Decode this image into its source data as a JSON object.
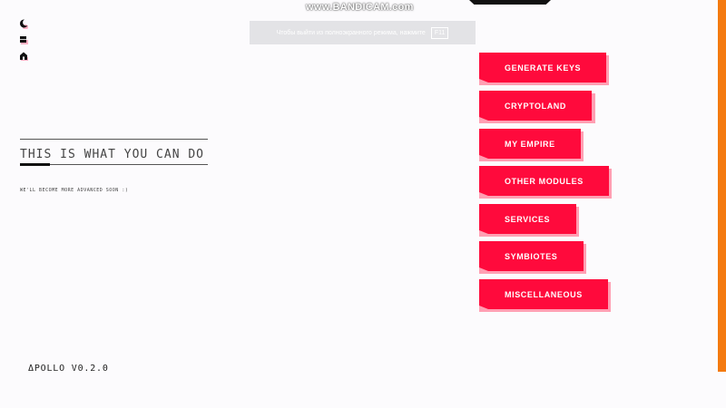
{
  "watermark": "www.BANDICAM.com",
  "fullscreen_notice": {
    "text": "Чтобы выйти из полноэкранного режима, нажмите",
    "key": "F11"
  },
  "heading": {
    "title": "THIS IS WHAT YOU CAN DO",
    "subtitle": "WE'LL BECOME MORE ADVANCED SOON :)"
  },
  "version": "ΔPOLLO V0.2.0",
  "menu": [
    {
      "label": "GENERATE KEYS"
    },
    {
      "label": "CRYPTOLAND"
    },
    {
      "label": "MY EMPIRE"
    },
    {
      "label": "OTHER MODULES"
    },
    {
      "label": "SERVICES"
    },
    {
      "label": "SYMBIOTES"
    },
    {
      "label": "MISCELLANEOUS"
    }
  ],
  "icons": [
    "moon-icon",
    "grid-icon",
    "home-icon"
  ],
  "colors": {
    "accent": "#ff0a3c",
    "side_bar": "#f47a10",
    "background": "#fcfbfd"
  }
}
